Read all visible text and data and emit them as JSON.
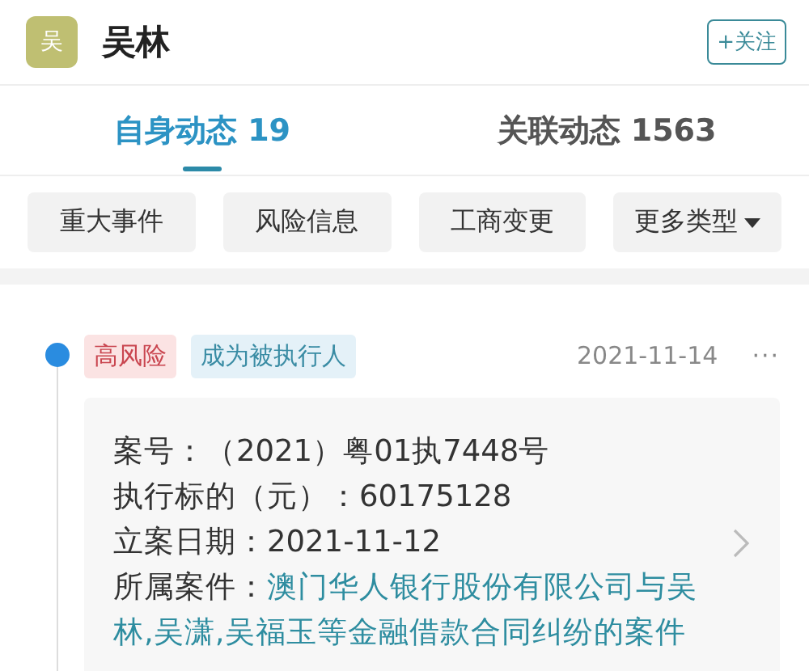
{
  "header": {
    "avatar": "吴",
    "name": "吴林",
    "follow_button": "+关注"
  },
  "tabs": [
    {
      "label": "自身动态 19",
      "selected": true
    },
    {
      "label": "关联动态 1563",
      "selected": false
    }
  ],
  "filters": [
    {
      "label": "重大事件",
      "dropdown": false
    },
    {
      "label": "风险信息",
      "dropdown": false
    },
    {
      "label": "工商变更",
      "dropdown": false
    },
    {
      "label": "更多类型",
      "dropdown": true
    }
  ],
  "events": [
    {
      "tags": [
        {
          "label": "高风险",
          "kind": "risk"
        },
        {
          "label": "成为被执行人",
          "kind": "type"
        }
      ],
      "date": "2021-11-14",
      "more": "···",
      "fields": [
        {
          "label": "案号：",
          "value": "（2021）粤01执7448号",
          "kind": "text"
        },
        {
          "label": "执行标的（元）：",
          "value": "60175128",
          "kind": "text"
        },
        {
          "label": "立案日期：",
          "value": "2021-11-12",
          "kind": "text"
        },
        {
          "label": "所属案件：",
          "value": "澳门华人银行股份有限公司与吴林,吴潇,吴福玉等金融借款合同纠纷的案件",
          "kind": "link"
        }
      ]
    }
  ]
}
